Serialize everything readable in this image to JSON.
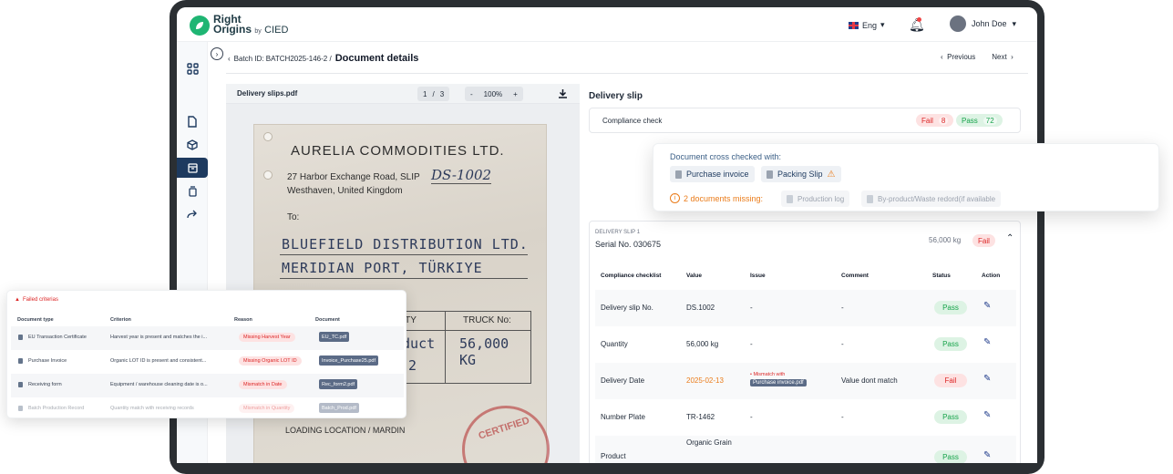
{
  "brand": {
    "line1": "Right",
    "line2": "Origins",
    "by": "by",
    "org": "CIED"
  },
  "header": {
    "language": "Eng",
    "user_name": "John Doe"
  },
  "breadcrumb": {
    "batch": "Batch ID: BATCH2025-146-2 /",
    "page": "Document details"
  },
  "pager": {
    "previous": "Previous",
    "next": "Next"
  },
  "viewer": {
    "file_name": "Delivery slips.pdf",
    "page_current": "1",
    "page_sep": "/",
    "page_total": "3",
    "zoom_minus": "-",
    "zoom": "100%",
    "zoom_plus": "+",
    "document": {
      "company": "AURELIA COMMODITIES LTD.",
      "address1": "27 Harbor Exchange Road, SLIP",
      "slip_no": "DS-1002",
      "address2": "Westhaven, United Kingdom",
      "to": "To:",
      "recipient1": "BLUEFIELD DISTRIBUTION LTD.",
      "recipient2": "MERIDIAN PORT, TÜRKIYE",
      "col_quantity": "NTITY",
      "col_truck": "TRUCK No:",
      "cell_product": "oduct",
      "cell_truck": "56,000 KG",
      "cell_two": "2",
      "loading": "LOADING LOCATION / MARDIN",
      "stamp": "CERTIFIED"
    }
  },
  "panel": {
    "title": "Delivery slip",
    "compliance_label": "Compliance check",
    "fail_label": "Fail",
    "fail_count": "8",
    "pass_label": "Pass",
    "pass_count": "72"
  },
  "crosscheck": {
    "title": "Document cross checked with:",
    "docs": [
      "Purchase invoice",
      "Packing Slip"
    ],
    "missing_label": "2 documents missing:",
    "missing_docs": [
      "Production log",
      "By-product/Waste redord(if available"
    ]
  },
  "slip": {
    "tag": "DELIVERY SLIP 1",
    "serial": "Serial No. 030675",
    "weight": "56,000 kg",
    "status": "Fail",
    "columns": [
      "Compliance checklist",
      "Value",
      "Issue",
      "Comment",
      "Status",
      "Action"
    ],
    "rows": [
      {
        "item": "Delivery slip No.",
        "value": "DS.1002",
        "issue": "-",
        "comment": "-",
        "status": "Pass"
      },
      {
        "item": "Quantity",
        "value": "56,000 kg",
        "issue": "-",
        "comment": "-",
        "status": "Pass"
      },
      {
        "item": "Delivery Date",
        "value": "2025-02-13",
        "issue_note": "Mismatch with",
        "issue_doc": "Purchase invoice.pdf",
        "comment": "Value dont match",
        "status": "Fail"
      },
      {
        "item": "Number Plate",
        "value": "TR-1462",
        "issue": "-",
        "comment": "-",
        "status": "Pass"
      },
      {
        "item": "Product",
        "value": "Organic Grain",
        "issue": "",
        "comment": "",
        "status": "Pass"
      }
    ]
  },
  "failed": {
    "title": "Failed criterias",
    "columns": [
      "Document type",
      "Criterion",
      "Reason",
      "Document"
    ],
    "rows": [
      {
        "type": "EU Transaction Certificate",
        "criterion": "Harvest year is present and matches the i...",
        "reason": "Missing Harvest Year",
        "doc": "EU_TC.pdf"
      },
      {
        "type": "Purchase Invoice",
        "criterion": "Organic LOT ID is present and consistent...",
        "reason": "Missing Organic LOT ID",
        "doc": "Invoice_Purchase25.pdf"
      },
      {
        "type": "Receiving form",
        "criterion": "Equipment / warehouse cleaning date is o...",
        "reason": "Mismatch in Date",
        "doc": "Rec_form2.pdf"
      },
      {
        "type": "Batch Production Record",
        "criterion": "Quantity match with receiving records",
        "reason": "Mismatch in Quantity",
        "doc": "Batch_Prod.pdf"
      }
    ]
  },
  "colors": {
    "accent": "#1e3a5f",
    "brand": "#1fb573",
    "fail": "#dc2626",
    "pass": "#16a34a",
    "warn": "#ea7c1b"
  }
}
